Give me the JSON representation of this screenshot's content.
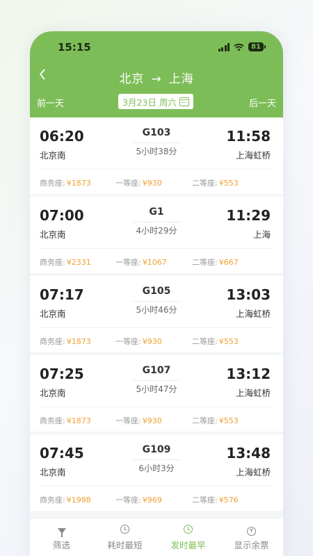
{
  "status": {
    "time": "15:15",
    "battery": "81"
  },
  "header": {
    "from": "北京",
    "arrow": "→",
    "to": "上海",
    "prev_day": "前一天",
    "next_day": "后一天",
    "date": "3月23日",
    "weekday": "周六"
  },
  "colors": {
    "brand": "#7dbd57",
    "price": "#f0a030"
  },
  "icons": {
    "back": "chevron-left-icon",
    "calendar": "calendar-icon",
    "filter": "filter-icon",
    "duration": "timer-icon",
    "departure": "alarm-clock-icon",
    "remaining": "yen-icon"
  },
  "trains": [
    {
      "dep_time": "06:20",
      "dep_station": "北京南",
      "train_no": "G103",
      "duration": "5小时38分",
      "arr_time": "11:58",
      "arr_station": "上海虹桥",
      "seats": [
        {
          "label": "商务座:",
          "price": "¥1873"
        },
        {
          "label": "一等座:",
          "price": "¥930"
        },
        {
          "label": "二等座:",
          "price": "¥553"
        }
      ]
    },
    {
      "dep_time": "07:00",
      "dep_station": "北京南",
      "train_no": "G1",
      "duration": "4小时29分",
      "arr_time": "11:29",
      "arr_station": "上海",
      "seats": [
        {
          "label": "商务座:",
          "price": "¥2331"
        },
        {
          "label": "一等座:",
          "price": "¥1067"
        },
        {
          "label": "二等座:",
          "price": "¥667"
        }
      ]
    },
    {
      "dep_time": "07:17",
      "dep_station": "北京南",
      "train_no": "G105",
      "duration": "5小时46分",
      "arr_time": "13:03",
      "arr_station": "上海虹桥",
      "seats": [
        {
          "label": "商务座:",
          "price": "¥1873"
        },
        {
          "label": "一等座:",
          "price": "¥930"
        },
        {
          "label": "二等座:",
          "price": "¥553"
        }
      ]
    },
    {
      "dep_time": "07:25",
      "dep_station": "北京南",
      "train_no": "G107",
      "duration": "5小时47分",
      "arr_time": "13:12",
      "arr_station": "上海虹桥",
      "seats": [
        {
          "label": "商务座:",
          "price": "¥1873"
        },
        {
          "label": "一等座:",
          "price": "¥930"
        },
        {
          "label": "二等座:",
          "price": "¥553"
        }
      ]
    },
    {
      "dep_time": "07:45",
      "dep_station": "北京南",
      "train_no": "G109",
      "duration": "6小时3分",
      "arr_time": "13:48",
      "arr_station": "上海虹桥",
      "seats": [
        {
          "label": "商务座:",
          "price": "¥1998"
        },
        {
          "label": "一等座:",
          "price": "¥969"
        },
        {
          "label": "二等座:",
          "price": "¥576"
        }
      ]
    }
  ],
  "tabs": [
    {
      "label": "筛选",
      "active": false
    },
    {
      "label": "耗时最短",
      "active": false
    },
    {
      "label": "发时最早",
      "active": true
    },
    {
      "label": "显示余票",
      "active": false
    }
  ]
}
